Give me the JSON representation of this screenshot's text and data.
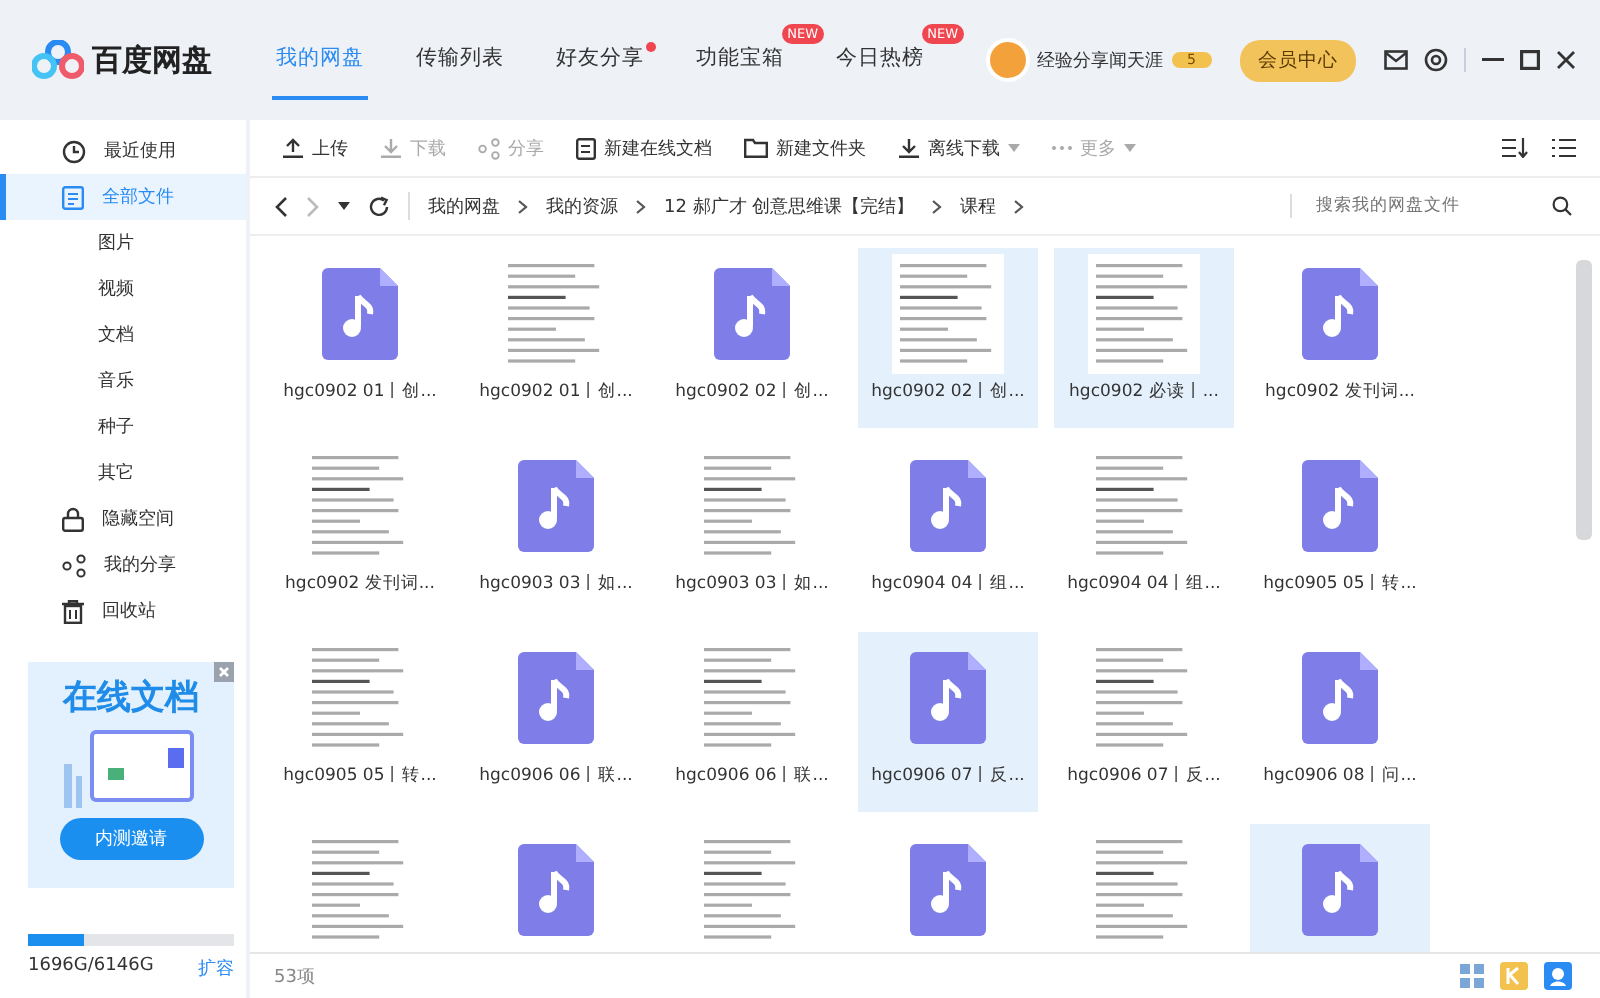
{
  "app": {
    "name": "百度网盘"
  },
  "tabs": [
    {
      "label": "我的网盘",
      "selected": true,
      "notification": false
    },
    {
      "label": "传输列表",
      "selected": false,
      "notification": false
    },
    {
      "label": "好友分享",
      "selected": false,
      "notification": true
    },
    {
      "label": "功能宝箱",
      "selected": false,
      "notification": false,
      "badge": "NEW"
    },
    {
      "label": "今日热榜",
      "selected": false,
      "notification": false,
      "badge": "NEW"
    }
  ],
  "user": {
    "name": "经验分享闻天涯",
    "level": "5",
    "vip_button": "会员中心"
  },
  "sidebar": {
    "items": [
      {
        "label": "最近使用",
        "selected": false
      },
      {
        "label": "全部文件",
        "selected": true,
        "children": [
          {
            "label": "图片",
            "selected": false
          },
          {
            "label": "视频",
            "selected": false
          },
          {
            "label": "文档",
            "selected": false
          },
          {
            "label": "音乐",
            "selected": false
          },
          {
            "label": "种子",
            "selected": false
          },
          {
            "label": "其它",
            "selected": false
          }
        ]
      },
      {
        "label": "隐藏空间",
        "selected": false
      },
      {
        "label": "我的分享",
        "selected": false
      },
      {
        "label": "回收站",
        "selected": false
      }
    ],
    "promo": {
      "title": "在线文档",
      "button": "内测邀请"
    },
    "storage": {
      "usage": "1696G/6146G",
      "level": 0.276,
      "expand": "扩容"
    }
  },
  "toolbar": [
    {
      "label": "上传",
      "disabled": false,
      "dropdown": false
    },
    {
      "label": "下载",
      "disabled": true,
      "dropdown": false
    },
    {
      "label": "分享",
      "disabled": true,
      "dropdown": false
    },
    {
      "label": "新建在线文档",
      "disabled": false,
      "dropdown": false
    },
    {
      "label": "新建文件夹",
      "disabled": false,
      "dropdown": false
    },
    {
      "label": "离线下载",
      "disabled": false,
      "dropdown": true
    },
    {
      "label": "更多",
      "disabled": true,
      "dropdown": true
    }
  ],
  "breadcrumb": [
    "我的网盘",
    "我的资源",
    "12 郝广才 创意思维课【完结】",
    "课程"
  ],
  "search": {
    "placeholder": "搜索我的网盘文件"
  },
  "files": [
    {
      "kind": "audio",
      "label": "hgc0902 01丨创...",
      "selected": false
    },
    {
      "kind": "doc",
      "label": "hgc0902 01丨创...",
      "selected": false
    },
    {
      "kind": "audio",
      "label": "hgc0902 02丨创...",
      "selected": false
    },
    {
      "kind": "doc",
      "label": "hgc0902 02丨创...",
      "selected": true
    },
    {
      "kind": "doc",
      "label": "hgc0902 必读丨...",
      "selected": true
    },
    {
      "kind": "audio",
      "label": "hgc0902 发刊词...",
      "selected": false
    },
    {
      "kind": "doc",
      "label": "hgc0902 发刊词...",
      "selected": false
    },
    {
      "kind": "audio",
      "label": "hgc0903 03丨如...",
      "selected": false
    },
    {
      "kind": "doc",
      "label": "hgc0903 03丨如...",
      "selected": false
    },
    {
      "kind": "audio",
      "label": "hgc0904 04丨组...",
      "selected": false
    },
    {
      "kind": "doc",
      "label": "hgc0904 04丨组...",
      "selected": false
    },
    {
      "kind": "audio",
      "label": "hgc0905 05丨转...",
      "selected": false
    },
    {
      "kind": "doc",
      "label": "hgc0905 05丨转...",
      "selected": false
    },
    {
      "kind": "audio",
      "label": "hgc0906 06丨联...",
      "selected": false
    },
    {
      "kind": "doc",
      "label": "hgc0906 06丨联...",
      "selected": false
    },
    {
      "kind": "audio",
      "label": "hgc0906 07丨反...",
      "selected": true
    },
    {
      "kind": "doc",
      "label": "hgc0906 07丨反...",
      "selected": false
    },
    {
      "kind": "audio",
      "label": "hgc0906 08丨问...",
      "selected": false
    },
    {
      "kind": "doc",
      "selected": false
    },
    {
      "kind": "audio",
      "selected": false
    },
    {
      "kind": "doc",
      "selected": false
    },
    {
      "kind": "audio",
      "selected": false
    },
    {
      "kind": "doc",
      "selected": false
    },
    {
      "kind": "audio",
      "selected": true
    }
  ],
  "status_bar": {
    "count": "53项"
  }
}
